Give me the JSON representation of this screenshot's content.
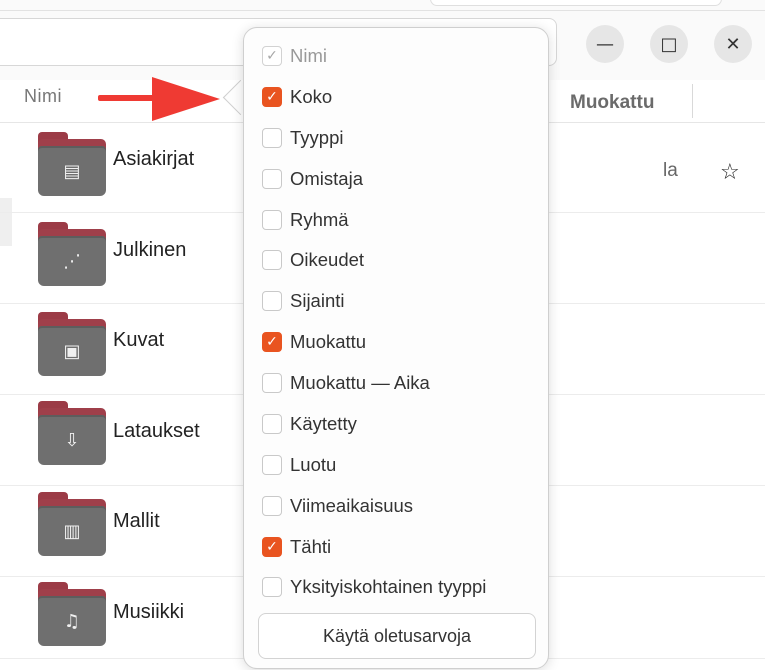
{
  "window": {
    "controls": {
      "minimize_glyph": "—",
      "maximize_glyph": "□",
      "close_glyph": "✕"
    }
  },
  "header": {
    "name_column": "Nimi",
    "modified_column": "Muokattu"
  },
  "files": [
    {
      "name": "Asiakirjat",
      "icon": "document-folder-icon"
    },
    {
      "name": "Julkinen",
      "icon": "share-folder-icon"
    },
    {
      "name": "Kuvat",
      "icon": "pictures-folder-icon"
    },
    {
      "name": "Lataukset",
      "icon": "downloads-folder-icon"
    },
    {
      "name": "Mallit",
      "icon": "templates-folder-icon"
    },
    {
      "name": "Musiikki",
      "icon": "music-folder-icon"
    }
  ],
  "row_preview": {
    "modified_text": "la",
    "star_glyph": "☆"
  },
  "menu": {
    "items": [
      {
        "label": "Nimi",
        "checked": true,
        "disabled": true
      },
      {
        "label": "Koko",
        "checked": true,
        "disabled": false
      },
      {
        "label": "Tyyppi",
        "checked": false,
        "disabled": false
      },
      {
        "label": "Omistaja",
        "checked": false,
        "disabled": false
      },
      {
        "label": "Ryhmä",
        "checked": false,
        "disabled": false
      },
      {
        "label": "Oikeudet",
        "checked": false,
        "disabled": false
      },
      {
        "label": "Sijainti",
        "checked": false,
        "disabled": false
      },
      {
        "label": "Muokattu",
        "checked": true,
        "disabled": false
      },
      {
        "label": "Muokattu — Aika",
        "checked": false,
        "disabled": false
      },
      {
        "label": "Käytetty",
        "checked": false,
        "disabled": false
      },
      {
        "label": "Luotu",
        "checked": false,
        "disabled": false
      },
      {
        "label": "Viimeaikaisuus",
        "checked": false,
        "disabled": false
      },
      {
        "label": "Tähti",
        "checked": true,
        "disabled": false
      },
      {
        "label": "Yksityiskohtainen tyyppi",
        "checked": false,
        "disabled": false
      }
    ],
    "default_button": "Käytä oletusarvoja"
  },
  "colors": {
    "accent": "#E95420",
    "arrow": "#EF3A33",
    "folder_tab": "#9F3F4A",
    "folder_body": "#6F6F6F"
  }
}
